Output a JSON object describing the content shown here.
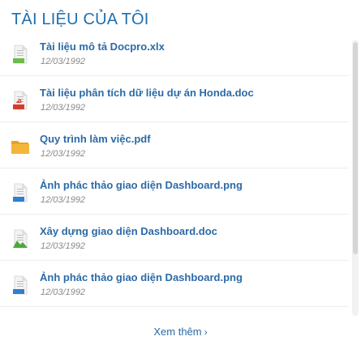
{
  "header": {
    "title": "TÀI LIỆU CỦA TÔI"
  },
  "documents": [
    {
      "name": "Tài liệu mô tả Docpro.xlx",
      "date": "12/03/1992",
      "icon": "xls-file-icon",
      "badge": "XLS",
      "accent": "#6dbb4a"
    },
    {
      "name": "Tài liệu phân tích dữ liệu dự án Honda.doc",
      "date": "12/03/1992",
      "icon": "pdf-file-icon",
      "badge": "PDF",
      "accent": "#d83b2b"
    },
    {
      "name": "Quy trình làm việc.pdf",
      "date": "12/03/1992",
      "icon": "folder-icon",
      "badge": "",
      "accent": "#f4b63a"
    },
    {
      "name": "Ảnh phác thảo giao diện Dashboard.png",
      "date": "12/03/1992",
      "icon": "doc-file-icon",
      "badge": "DOC",
      "accent": "#2f7fd1"
    },
    {
      "name": "Xây dựng giao diện Dashboard.doc",
      "date": "12/03/1992",
      "icon": "green-file-icon",
      "badge": "",
      "accent": "#4aa83a"
    },
    {
      "name": "Ảnh phác thảo giao diện Dashboard.png",
      "date": "12/03/1992",
      "icon": "doc-file-icon",
      "badge": "DOC",
      "accent": "#2f7fd1"
    }
  ],
  "footer": {
    "see_more": "Xem thêm",
    "chevron": "›"
  }
}
